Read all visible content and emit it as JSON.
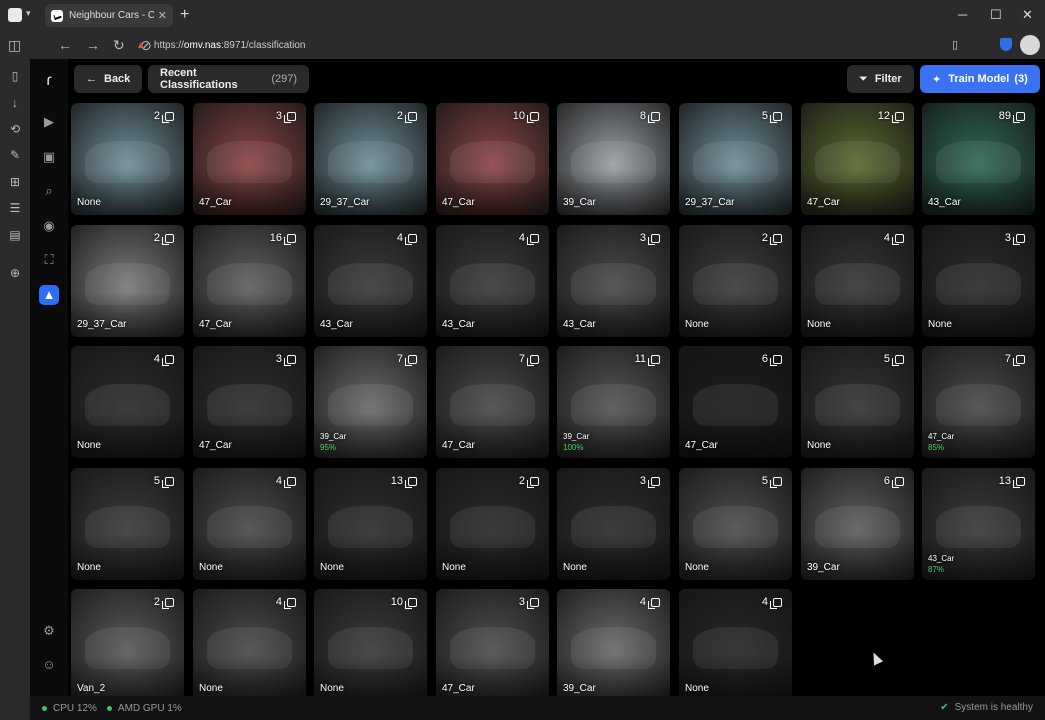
{
  "browser": {
    "tab_title": "Neighbour Cars - Classifica",
    "url_prefix": "https://",
    "url_host": "omv.nas",
    "url_rest": ":8971/classification"
  },
  "toolbar": {
    "back_label": "Back",
    "recent_label": "Recent Classifications",
    "recent_count": "(297)",
    "filter_label": "Filter",
    "train_label": "Train Model",
    "train_count": "(3)"
  },
  "tiles": [
    {
      "count": "2",
      "label": "None",
      "tone": "#6f8f9a",
      "conf": ""
    },
    {
      "count": "3",
      "label": "47_Car",
      "tone": "#8b4646",
      "conf": ""
    },
    {
      "count": "2",
      "label": "29_37_Car",
      "tone": "#6f8f9a",
      "conf": ""
    },
    {
      "count": "10",
      "label": "47_Car",
      "tone": "#8b4646",
      "conf": ""
    },
    {
      "count": "8",
      "label": "39_Car",
      "tone": "#9aa0a6",
      "conf": ""
    },
    {
      "count": "5",
      "label": "29_37_Car",
      "tone": "#6f8f9a",
      "conf": ""
    },
    {
      "count": "12",
      "label": "47_Car",
      "tone": "#5a6a2f",
      "conf": ""
    },
    {
      "count": "89",
      "label": "43_Car",
      "tone": "#2f6a55",
      "conf": ""
    },
    {
      "count": "2",
      "label": "29_37_Car",
      "tone": "#7a7a7a",
      "conf": ""
    },
    {
      "count": "16",
      "label": "47_Car",
      "tone": "#606060",
      "conf": ""
    },
    {
      "count": "4",
      "label": "43_Car",
      "tone": "#3a3a3a",
      "conf": ""
    },
    {
      "count": "4",
      "label": "43_Car",
      "tone": "#3a3a3a",
      "conf": ""
    },
    {
      "count": "3",
      "label": "43_Car",
      "tone": "#4a4a4a",
      "conf": ""
    },
    {
      "count": "2",
      "label": "None",
      "tone": "#3c3c3c",
      "conf": ""
    },
    {
      "count": "4",
      "label": "None",
      "tone": "#363636",
      "conf": ""
    },
    {
      "count": "3",
      "label": "None",
      "tone": "#2c2c2c",
      "conf": ""
    },
    {
      "count": "4",
      "label": "None",
      "tone": "#2c2c2c",
      "conf": ""
    },
    {
      "count": "3",
      "label": "47_Car",
      "tone": "#2e2e2e",
      "conf": ""
    },
    {
      "count": "7",
      "label": "39_Car",
      "tone": "#6a6a6a",
      "conf": "95%"
    },
    {
      "count": "7",
      "label": "47_Car",
      "tone": "#4a4a4a",
      "conf": ""
    },
    {
      "count": "11",
      "label": "39_Car",
      "tone": "#555555",
      "conf": "100%"
    },
    {
      "count": "6",
      "label": "47_Car",
      "tone": "#1c1c1c",
      "conf": ""
    },
    {
      "count": "5",
      "label": "None",
      "tone": "#343434",
      "conf": ""
    },
    {
      "count": "7",
      "label": "47_Car",
      "tone": "#4a4a4a",
      "conf": "85%"
    },
    {
      "count": "5",
      "label": "None",
      "tone": "#3a3a3a",
      "conf": ""
    },
    {
      "count": "4",
      "label": "None",
      "tone": "#4a4a4a",
      "conf": ""
    },
    {
      "count": "13",
      "label": "None",
      "tone": "#2e2e2e",
      "conf": ""
    },
    {
      "count": "2",
      "label": "None",
      "tone": "#2a2a2a",
      "conf": ""
    },
    {
      "count": "3",
      "label": "None",
      "tone": "#2c2c2c",
      "conf": ""
    },
    {
      "count": "5",
      "label": "None",
      "tone": "#4e4e4e",
      "conf": ""
    },
    {
      "count": "6",
      "label": "39_Car",
      "tone": "#5e5e5e",
      "conf": ""
    },
    {
      "count": "13",
      "label": "43_Car",
      "tone": "#3a3a3a",
      "conf": "87%"
    },
    {
      "count": "2",
      "label": "Van_2",
      "tone": "#5a5a5a",
      "conf": ""
    },
    {
      "count": "4",
      "label": "None",
      "tone": "#4a4a4a",
      "conf": ""
    },
    {
      "count": "10",
      "label": "None",
      "tone": "#3a3a3a",
      "conf": ""
    },
    {
      "count": "3",
      "label": "47_Car",
      "tone": "#4e4e4e",
      "conf": ""
    },
    {
      "count": "4",
      "label": "39_Car",
      "tone": "#6a6a6a",
      "conf": ""
    },
    {
      "count": "4",
      "label": "None",
      "tone": "#262626",
      "conf": ""
    }
  ],
  "status": {
    "cpu": "CPU 12%",
    "gpu": "AMD GPU 1%",
    "health": "System is healthy"
  },
  "colors": {
    "accent": "#3a72f2",
    "healthy": "#3cc45d",
    "confidence": "#4ccb6a"
  }
}
